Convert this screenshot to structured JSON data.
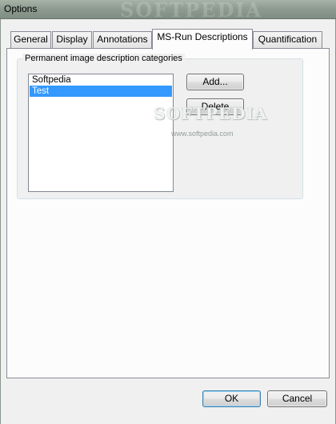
{
  "window": {
    "title": "Options",
    "watermark": "SOFTPEDIA"
  },
  "tabs": [
    {
      "label": "General"
    },
    {
      "label": "Display"
    },
    {
      "label": "Annotations"
    },
    {
      "label": "MS-Run Descriptions",
      "active": true
    },
    {
      "label": "Quantification"
    }
  ],
  "group": {
    "label": "Permanent image description categories",
    "items": [
      "Softpedia",
      "Test"
    ],
    "selected_index": 1
  },
  "buttons": {
    "add": "Add...",
    "delete": "Delete",
    "ok": "OK",
    "cancel": "Cancel"
  },
  "watermarks": {
    "center": "SOFTPEDIA",
    "url": "www.softpedia.com"
  },
  "colors": {
    "selection": "#3399ff",
    "dialog_bg": "#f0f0f0",
    "panel_bg": "#fcfcfc"
  }
}
